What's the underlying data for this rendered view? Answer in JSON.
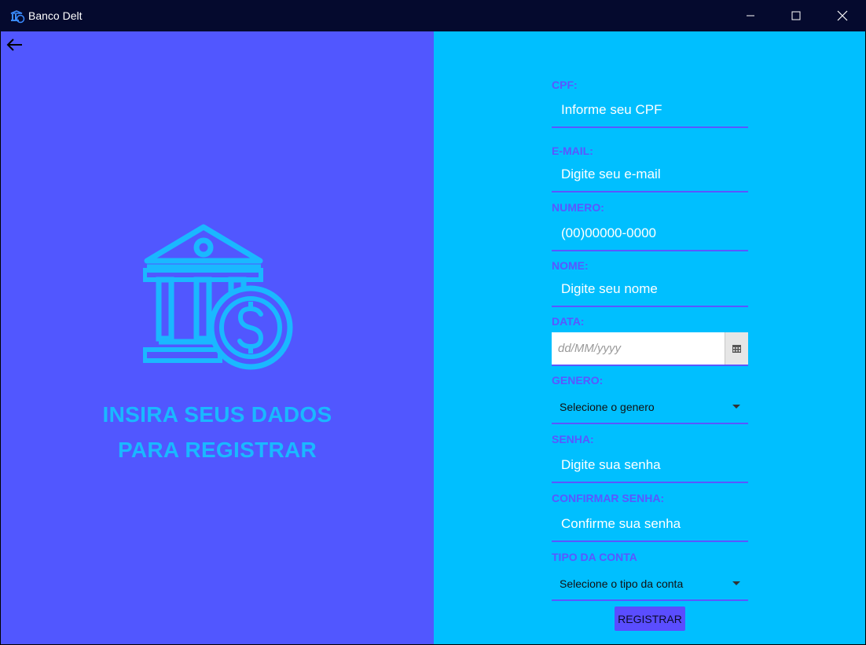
{
  "window": {
    "title": "Banco Delt"
  },
  "left_panel": {
    "headline_line1": "INSIRA SEUS DADOS",
    "headline_line2": "PARA REGISTRAR"
  },
  "form": {
    "cpf": {
      "label": "CPF:",
      "placeholder": "Informe seu CPF"
    },
    "email": {
      "label": "E-MAIL:",
      "placeholder": "Digite seu e-mail"
    },
    "numero": {
      "label": "NUMERO:",
      "placeholder": "(00)00000-0000"
    },
    "nome": {
      "label": "NOME:",
      "placeholder": "Digite seu nome"
    },
    "data": {
      "label": "DATA:",
      "placeholder": "dd/MM/yyyy"
    },
    "genero": {
      "label": "GENERO:",
      "selected": "Selecione o genero"
    },
    "senha": {
      "label": "SENHA:",
      "placeholder": "Digite sua senha"
    },
    "confirmar_senha": {
      "label": "CONFIRMAR SENHA:",
      "placeholder": "Confirme sua senha"
    },
    "tipo_conta": {
      "label": "TIPO DA CONTA",
      "selected": "Selecione o tipo da conta"
    },
    "submit_label": "REGISTRAR"
  },
  "colors": {
    "titlebar": "#050a2e",
    "left_bg": "#5157ff",
    "right_bg": "#00bfff",
    "accent": "#1ab8ff",
    "label": "#5a57ff"
  },
  "icons": [
    "app-logo-icon",
    "minimize-icon",
    "maximize-icon",
    "close-icon",
    "back-arrow-icon",
    "bank-dollar-icon",
    "calendar-icon",
    "chevron-down-icon"
  ]
}
